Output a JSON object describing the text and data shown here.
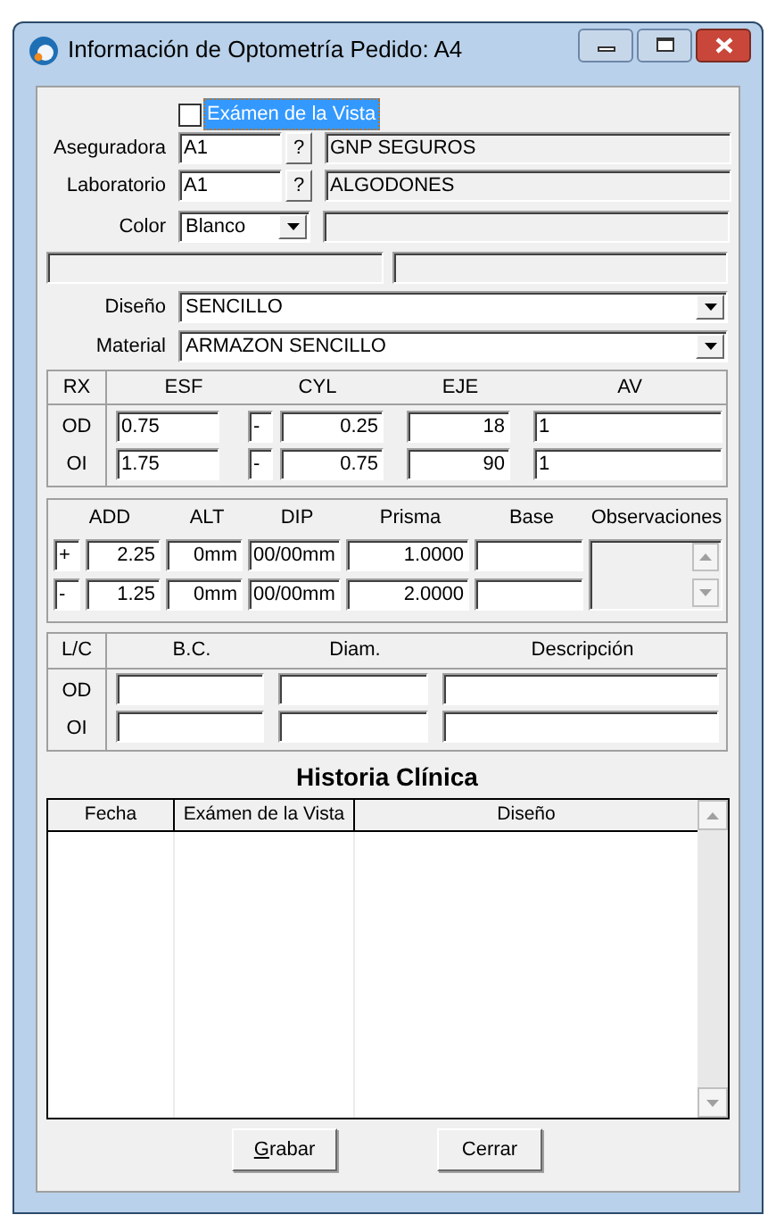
{
  "window": {
    "title": "Información de Optometría Pedido: A4"
  },
  "exam_checkbox": {
    "label": "Exámen de la Vista",
    "checked": false,
    "focused": true
  },
  "lookups": [
    {
      "label": "Aseguradora",
      "code": "A1",
      "button": "?",
      "name": "GNP SEGUROS"
    },
    {
      "label": "Laboratorio",
      "code": "A1",
      "button": "?",
      "name": "ALGODONES"
    }
  ],
  "color": {
    "label": "Color",
    "value": "Blanco"
  },
  "design": {
    "label": "Diseño",
    "value": "SENCILLO"
  },
  "material": {
    "label": "Material",
    "value": "ARMAZON SENCILLO"
  },
  "rx": {
    "columns": [
      "RX",
      "ESF",
      "CYL",
      "EJE",
      "AV"
    ],
    "rows": [
      {
        "eye": "OD",
        "esf": "0.75",
        "cyl_sign": "-",
        "cyl": "0.25",
        "eje": "18",
        "av": "1"
      },
      {
        "eye": "OI",
        "esf": "1.75",
        "cyl_sign": "-",
        "cyl": "0.75",
        "eje": "90",
        "av": "1"
      }
    ]
  },
  "add": {
    "columns": [
      "ADD",
      "ALT",
      "DIP",
      "Prisma",
      "Base",
      "Observaciones"
    ],
    "rows": [
      {
        "sign": "+",
        "add": "2.25",
        "alt": "0mm",
        "dip": "00/00mm",
        "prisma": "1.0000"
      },
      {
        "sign": "-",
        "add": "1.25",
        "alt": "0mm",
        "dip": "00/00mm",
        "prisma": "2.0000"
      }
    ]
  },
  "lc": {
    "columns": [
      "L/C",
      "B.C.",
      "Diam.",
      "Descripción"
    ],
    "rows": [
      {
        "eye": "OD"
      },
      {
        "eye": "OI"
      }
    ]
  },
  "history": {
    "title": "Historia Clínica",
    "columns": [
      "Fecha",
      "Exámen de la Vista",
      "Diseño"
    ]
  },
  "buttons": [
    {
      "label": "Grabar",
      "underline_first": true
    },
    {
      "label": "Cerrar",
      "underline_first": false
    }
  ]
}
